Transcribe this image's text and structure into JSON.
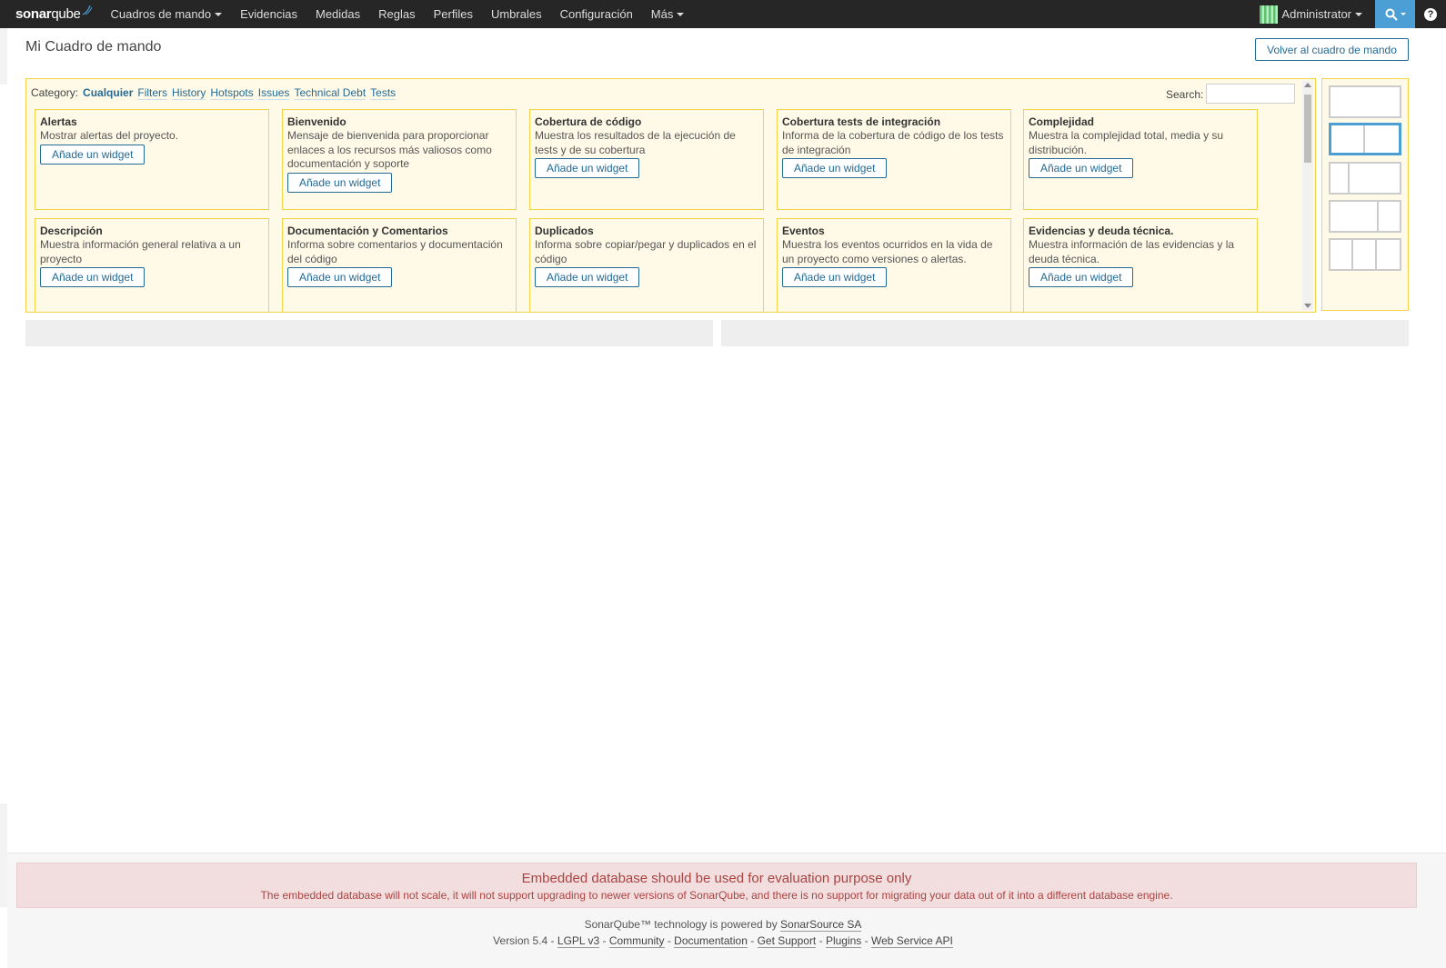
{
  "nav": {
    "logo_bold": "sonar",
    "logo_light": "qube",
    "items": [
      {
        "label": "Cuadros de mando",
        "dropdown": true
      },
      {
        "label": "Evidencias"
      },
      {
        "label": "Medidas"
      },
      {
        "label": "Reglas"
      },
      {
        "label": "Perfiles"
      },
      {
        "label": "Umbrales"
      },
      {
        "label": "Configuración"
      },
      {
        "label": "Más",
        "dropdown": true
      }
    ],
    "user": "Administrator",
    "accent": "#4b9fd5",
    "help_label": "?"
  },
  "page": {
    "title": "Mi Cuadro de mando",
    "back_button": "Volver al cuadro de mando"
  },
  "widgets_panel": {
    "category_label": "Category:",
    "categories": [
      "Cualquier",
      "Filters",
      "History",
      "Hotspots",
      "Issues",
      "Technical Debt",
      "Tests"
    ],
    "active_category": "Cualquier",
    "search_label": "Search:",
    "search_value": "",
    "add_button_label": "Añade un widget",
    "widgets": [
      {
        "title": "Alertas",
        "description": "Mostrar alertas del proyecto."
      },
      {
        "title": "Bienvenido",
        "description": "Mensaje de bienvenida para proporcionar enlaces a los recursos más valiosos como documentación y soporte"
      },
      {
        "title": "Cobertura de código",
        "description": "Muestra los resultados de la ejecución de tests y de su cobertura"
      },
      {
        "title": "Cobertura tests de integración",
        "description": "Informa de la cobertura de código de los tests de integración"
      },
      {
        "title": "Complejidad",
        "description": "Muestra la complejidad total, media y su distribución."
      },
      {
        "title": "Descripción",
        "description": "Muestra información general relativa a un proyecto"
      },
      {
        "title": "Documentación y Comentarios",
        "description": "Informa sobre comentarios y documentación del código"
      },
      {
        "title": "Duplicados",
        "description": "Informa sobre copiar/pegar y duplicados en el código"
      },
      {
        "title": "Eventos",
        "description": "Muestra los eventos ocurridos en la vida de un proyecto como versiones o alertas."
      },
      {
        "title": "Evidencias y deuda técnica.",
        "description": "Muestra información de las evidencias y la deuda técnica."
      }
    ]
  },
  "layouts": {
    "options": [
      "100%",
      "50%-50%",
      "30%-70%",
      "70%-30%",
      "33%-33%-33%"
    ],
    "selected": "50%-50%"
  },
  "footer": {
    "warning_title": "Embedded database should be used for evaluation purpose only",
    "warning_text": "The embedded database will not scale, it will not support upgrading to newer versions of SonarQube, and there is no support for migrating your data out of it into a different database engine.",
    "powered_prefix": "SonarQube™ technology is powered by",
    "powered_link": "SonarSource SA",
    "version": "Version 5.4",
    "links": [
      "LGPL v3",
      "Community",
      "Documentation",
      "Get Support",
      "Plugins",
      "Web Service API"
    ]
  }
}
